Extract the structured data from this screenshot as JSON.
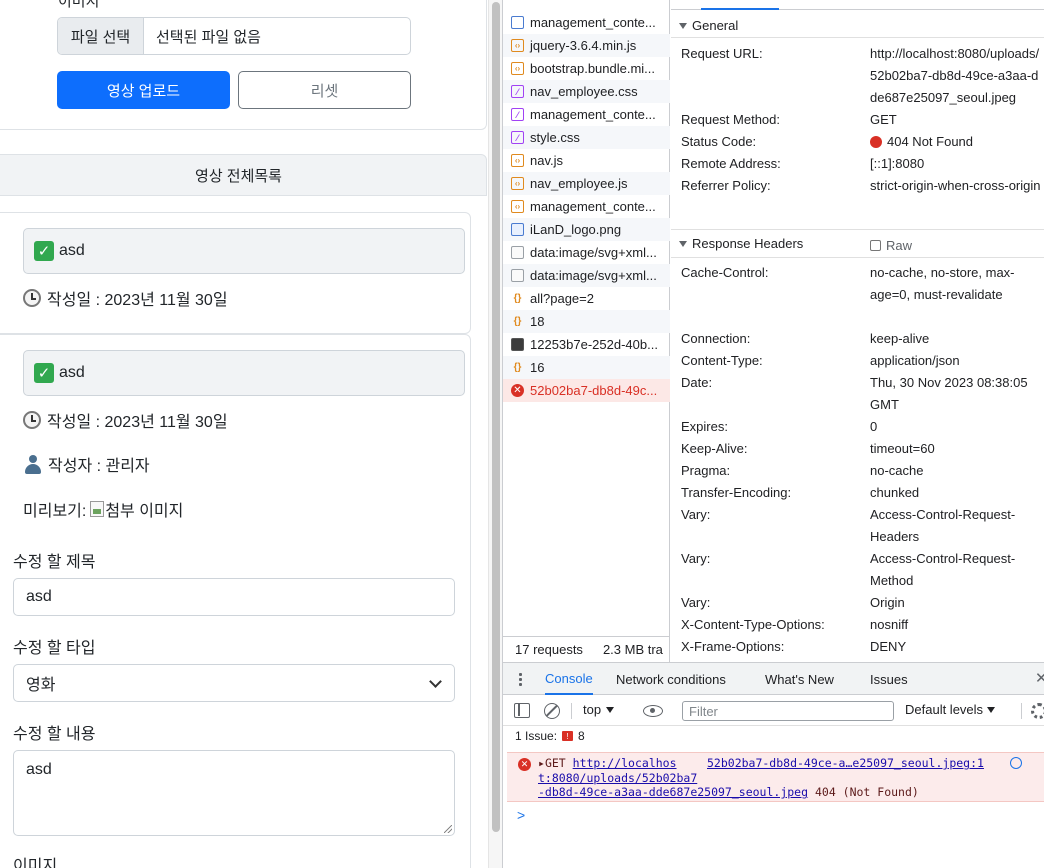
{
  "page": {
    "cut_label": "이미지",
    "file_button": "파일 선택",
    "file_status": "선택된 파일 없음",
    "upload_button": "영상 업로드",
    "reset_button": "리셋",
    "list_header": "영상 전체목록",
    "cards": [
      {
        "title": "asd",
        "date": "작성일 : 2023년 11월 30일"
      },
      {
        "title": "asd",
        "date": "작성일 : 2023년 11월 30일",
        "author": "작성자 : 관리자",
        "preview_label": "미리보기:",
        "preview_alt": "첨부 이미지",
        "edit_title_label": "수정 할 제목",
        "edit_title_value": "asd",
        "edit_type_label": "수정 할 타입",
        "edit_type_value": "영화",
        "edit_content_label": "수정 할 내용",
        "edit_content_value": "asd",
        "edit_image_label": "이미지"
      }
    ]
  },
  "devtools": {
    "requests": [
      {
        "name": "management_conte...",
        "icon": "doc-icon"
      },
      {
        "name": "jquery-3.6.4.min.js",
        "icon": "js-icon"
      },
      {
        "name": "bootstrap.bundle.mi...",
        "icon": "js-icon"
      },
      {
        "name": "nav_employee.css",
        "icon": "css-icon"
      },
      {
        "name": "management_conte...",
        "icon": "css-icon"
      },
      {
        "name": "style.css",
        "icon": "css-icon"
      },
      {
        "name": "nav.js",
        "icon": "js-icon"
      },
      {
        "name": "nav_employee.js",
        "icon": "js-icon"
      },
      {
        "name": "management_conte...",
        "icon": "js-icon"
      },
      {
        "name": "iLanD_logo.png",
        "icon": "image-icon"
      },
      {
        "name": "data:image/svg+xml...",
        "icon": "svg-icon"
      },
      {
        "name": "data:image/svg+xml...",
        "icon": "svg-icon"
      },
      {
        "name": "all?page=2",
        "icon": "json-icon"
      },
      {
        "name": "18",
        "icon": "json-icon"
      },
      {
        "name": "12253b7e-252d-40b...",
        "icon": "photo-icon"
      },
      {
        "name": "16",
        "icon": "json-icon"
      },
      {
        "name": "52b02ba7-db8d-49c...",
        "icon": "error-icon"
      }
    ],
    "summary": {
      "requests": "17 requests",
      "transferred": "2.3 MB tra"
    },
    "general": {
      "title": "General",
      "rows": [
        {
          "key": "Request URL:",
          "value": "http://localhost:8080/uploads/52b02ba7-db8d-49ce-a3aa-dde687e25097_seoul.jpeg"
        },
        {
          "key": "Request Method:",
          "value": "GET"
        },
        {
          "key": "Status Code:",
          "value": "404 Not Found"
        },
        {
          "key": "Remote Address:",
          "value": "[::1]:8080"
        },
        {
          "key": "Referrer Policy:",
          "value": "strict-origin-when-cross-origin"
        }
      ]
    },
    "response_headers": {
      "title": "Response Headers",
      "raw_label": "Raw",
      "rows": [
        {
          "key": "Cache-Control:",
          "value": "no-cache, no-store, max-age=0, must-revalidate"
        },
        {
          "key": "Connection:",
          "value": "keep-alive"
        },
        {
          "key": "Content-Type:",
          "value": "application/json"
        },
        {
          "key": "Date:",
          "value": "Thu, 30 Nov 2023 08:38:05 GMT"
        },
        {
          "key": "Expires:",
          "value": "0"
        },
        {
          "key": "Keep-Alive:",
          "value": "timeout=60"
        },
        {
          "key": "Pragma:",
          "value": "no-cache"
        },
        {
          "key": "Transfer-Encoding:",
          "value": "chunked"
        },
        {
          "key": "Vary:",
          "value": "Access-Control-Request-Headers"
        },
        {
          "key": "Vary:",
          "value": "Access-Control-Request-Method"
        },
        {
          "key": "Vary:",
          "value": "Origin"
        },
        {
          "key": "X-Content-Type-Options:",
          "value": "nosniff"
        },
        {
          "key": "X-Frame-Options:",
          "value": "DENY"
        }
      ]
    },
    "drawer": {
      "tabs": [
        "Console",
        "Network conditions",
        "What's New",
        "Issues"
      ],
      "context": "top",
      "filter_placeholder": "Filter",
      "levels": "Default levels",
      "issues_label": "1 Issue:",
      "issues_count": "8",
      "error": {
        "method": "GET",
        "url_part1": "http://localhos",
        "url_part2": "t:8080/uploads/52b02ba7",
        "url_part3": "-db8d-49ce-a3aa-dde687e25097_seoul.jpeg",
        "status": "404 (Not Found)",
        "source": "52b02ba7-db8d-49ce-a…e25097_seoul.jpeg:1"
      },
      "prompt": ">"
    }
  },
  "colors": {
    "primary": "#0d6efd",
    "error": "#d93025",
    "devtools_accent": "#1a73e8"
  }
}
